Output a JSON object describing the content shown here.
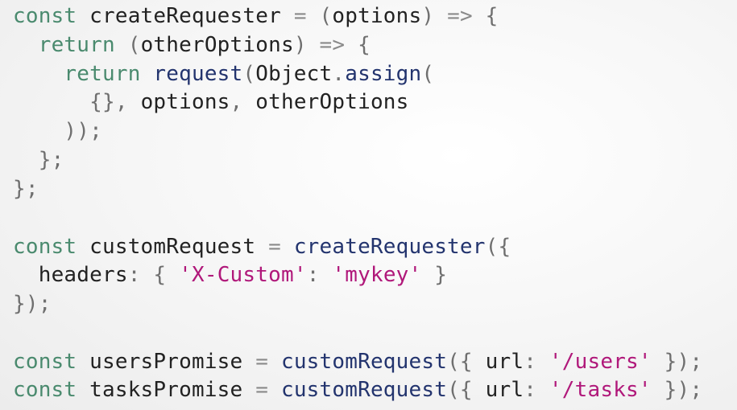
{
  "code": {
    "lines": [
      [
        {
          "t": "const",
          "c": "kw"
        },
        {
          "t": " ",
          "c": "sp"
        },
        {
          "t": "createRequester",
          "c": "id"
        },
        {
          "t": " ",
          "c": "sp"
        },
        {
          "t": "=",
          "c": "op"
        },
        {
          "t": " ",
          "c": "sp"
        },
        {
          "t": "(",
          "c": "p"
        },
        {
          "t": "options",
          "c": "id"
        },
        {
          "t": ")",
          "c": "p"
        },
        {
          "t": " ",
          "c": "sp"
        },
        {
          "t": "=>",
          "c": "op"
        },
        {
          "t": " ",
          "c": "sp"
        },
        {
          "t": "{",
          "c": "p"
        }
      ],
      [
        {
          "t": "  ",
          "c": "sp"
        },
        {
          "t": "return",
          "c": "kw"
        },
        {
          "t": " ",
          "c": "sp"
        },
        {
          "t": "(",
          "c": "p"
        },
        {
          "t": "otherOptions",
          "c": "id"
        },
        {
          "t": ")",
          "c": "p"
        },
        {
          "t": " ",
          "c": "sp"
        },
        {
          "t": "=>",
          "c": "op"
        },
        {
          "t": " ",
          "c": "sp"
        },
        {
          "t": "{",
          "c": "p"
        }
      ],
      [
        {
          "t": "    ",
          "c": "sp"
        },
        {
          "t": "return",
          "c": "kw"
        },
        {
          "t": " ",
          "c": "sp"
        },
        {
          "t": "request",
          "c": "fn"
        },
        {
          "t": "(",
          "c": "p"
        },
        {
          "t": "Object",
          "c": "id"
        },
        {
          "t": ".",
          "c": "p"
        },
        {
          "t": "assign",
          "c": "fn"
        },
        {
          "t": "(",
          "c": "p"
        }
      ],
      [
        {
          "t": "      ",
          "c": "sp"
        },
        {
          "t": "{}",
          "c": "p"
        },
        {
          "t": ",",
          "c": "p"
        },
        {
          "t": " ",
          "c": "sp"
        },
        {
          "t": "options",
          "c": "id"
        },
        {
          "t": ",",
          "c": "p"
        },
        {
          "t": " ",
          "c": "sp"
        },
        {
          "t": "otherOptions",
          "c": "id"
        }
      ],
      [
        {
          "t": "    ",
          "c": "sp"
        },
        {
          "t": "));",
          "c": "p"
        }
      ],
      [
        {
          "t": "  ",
          "c": "sp"
        },
        {
          "t": "};",
          "c": "p"
        }
      ],
      [
        {
          "t": "};",
          "c": "p"
        }
      ],
      [],
      [
        {
          "t": "const",
          "c": "kw"
        },
        {
          "t": " ",
          "c": "sp"
        },
        {
          "t": "customRequest",
          "c": "id"
        },
        {
          "t": " ",
          "c": "sp"
        },
        {
          "t": "=",
          "c": "op"
        },
        {
          "t": " ",
          "c": "sp"
        },
        {
          "t": "createRequester",
          "c": "fn"
        },
        {
          "t": "({",
          "c": "p"
        }
      ],
      [
        {
          "t": "  ",
          "c": "sp"
        },
        {
          "t": "headers",
          "c": "id"
        },
        {
          "t": ":",
          "c": "p"
        },
        {
          "t": " ",
          "c": "sp"
        },
        {
          "t": "{",
          "c": "p"
        },
        {
          "t": " ",
          "c": "sp"
        },
        {
          "t": "'X-Custom'",
          "c": "str"
        },
        {
          "t": ":",
          "c": "p"
        },
        {
          "t": " ",
          "c": "sp"
        },
        {
          "t": "'mykey'",
          "c": "str"
        },
        {
          "t": " ",
          "c": "sp"
        },
        {
          "t": "}",
          "c": "p"
        }
      ],
      [
        {
          "t": "});",
          "c": "p"
        }
      ],
      [],
      [
        {
          "t": "const",
          "c": "kw"
        },
        {
          "t": " ",
          "c": "sp"
        },
        {
          "t": "usersPromise",
          "c": "id"
        },
        {
          "t": " ",
          "c": "sp"
        },
        {
          "t": "=",
          "c": "op"
        },
        {
          "t": " ",
          "c": "sp"
        },
        {
          "t": "customRequest",
          "c": "fn"
        },
        {
          "t": "({",
          "c": "p"
        },
        {
          "t": " ",
          "c": "sp"
        },
        {
          "t": "url",
          "c": "id"
        },
        {
          "t": ":",
          "c": "p"
        },
        {
          "t": " ",
          "c": "sp"
        },
        {
          "t": "'/users'",
          "c": "str"
        },
        {
          "t": " ",
          "c": "sp"
        },
        {
          "t": "});",
          "c": "p"
        }
      ],
      [
        {
          "t": "const",
          "c": "kw"
        },
        {
          "t": " ",
          "c": "sp"
        },
        {
          "t": "tasksPromise",
          "c": "id"
        },
        {
          "t": " ",
          "c": "sp"
        },
        {
          "t": "=",
          "c": "op"
        },
        {
          "t": " ",
          "c": "sp"
        },
        {
          "t": "customRequest",
          "c": "fn"
        },
        {
          "t": "({",
          "c": "p"
        },
        {
          "t": " ",
          "c": "sp"
        },
        {
          "t": "url",
          "c": "id"
        },
        {
          "t": ":",
          "c": "p"
        },
        {
          "t": " ",
          "c": "sp"
        },
        {
          "t": "'/tasks'",
          "c": "str"
        },
        {
          "t": " ",
          "c": "sp"
        },
        {
          "t": "});",
          "c": "p"
        }
      ]
    ]
  }
}
